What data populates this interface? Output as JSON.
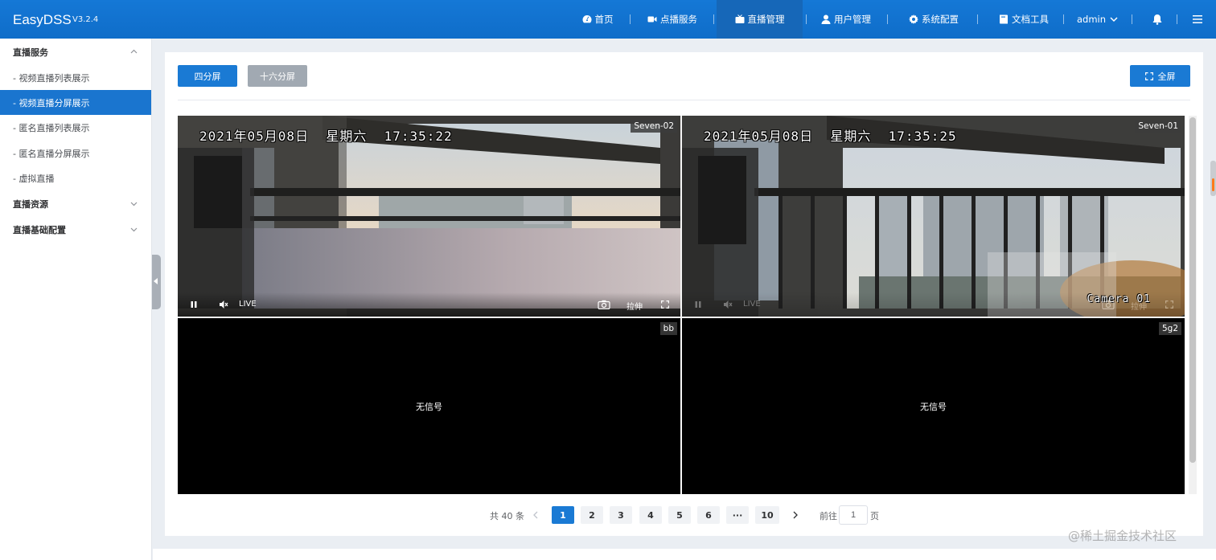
{
  "app": {
    "name": "EasyDSS",
    "version": "V3.2.4"
  },
  "nav": {
    "home": "首页",
    "vod": "点播服务",
    "live_mgmt": "直播管理",
    "user_mgmt": "用户管理",
    "sys_config": "系统配置",
    "docs": "文档工具",
    "user": "admin"
  },
  "sidebar": {
    "group1": "直播服务",
    "items": [
      "- 视频直播列表展示",
      "- 视频直播分屏展示",
      "- 匿名直播列表展示",
      "- 匿名直播分屏展示",
      "- 虚拟直播"
    ],
    "group2": "直播资源",
    "group3": "直播基础配置"
  },
  "toolbar": {
    "four_split": "四分屏",
    "sixteen_split": "十六分屏",
    "fullscreen": "全屏"
  },
  "cells": [
    {
      "name": "Seven-02",
      "osd": "2021年05月08日  星期六  17:35:22",
      "live": "LIVE",
      "stretch": "拉伸"
    },
    {
      "name": "Seven-01",
      "osd": "2021年05月08日  星期六  17:35:25",
      "camera": "Camera 01",
      "live": "LIVE",
      "stretch": "拉伸"
    },
    {
      "name": "bb",
      "no_signal": "无信号"
    },
    {
      "name": "5g2",
      "no_signal": "无信号"
    }
  ],
  "pagination": {
    "total": "共 40 条",
    "pages": [
      "1",
      "2",
      "3",
      "4",
      "5",
      "6",
      "···",
      "10"
    ],
    "current": "1",
    "goto_label": "前往",
    "goto_value": "1",
    "page_suffix": "页"
  },
  "watermark": "@稀土掘金技术社区",
  "colors": {
    "topbar": "#1578d6",
    "primary": "#1a7ad4",
    "active_sidebar": "#1a75cf"
  }
}
